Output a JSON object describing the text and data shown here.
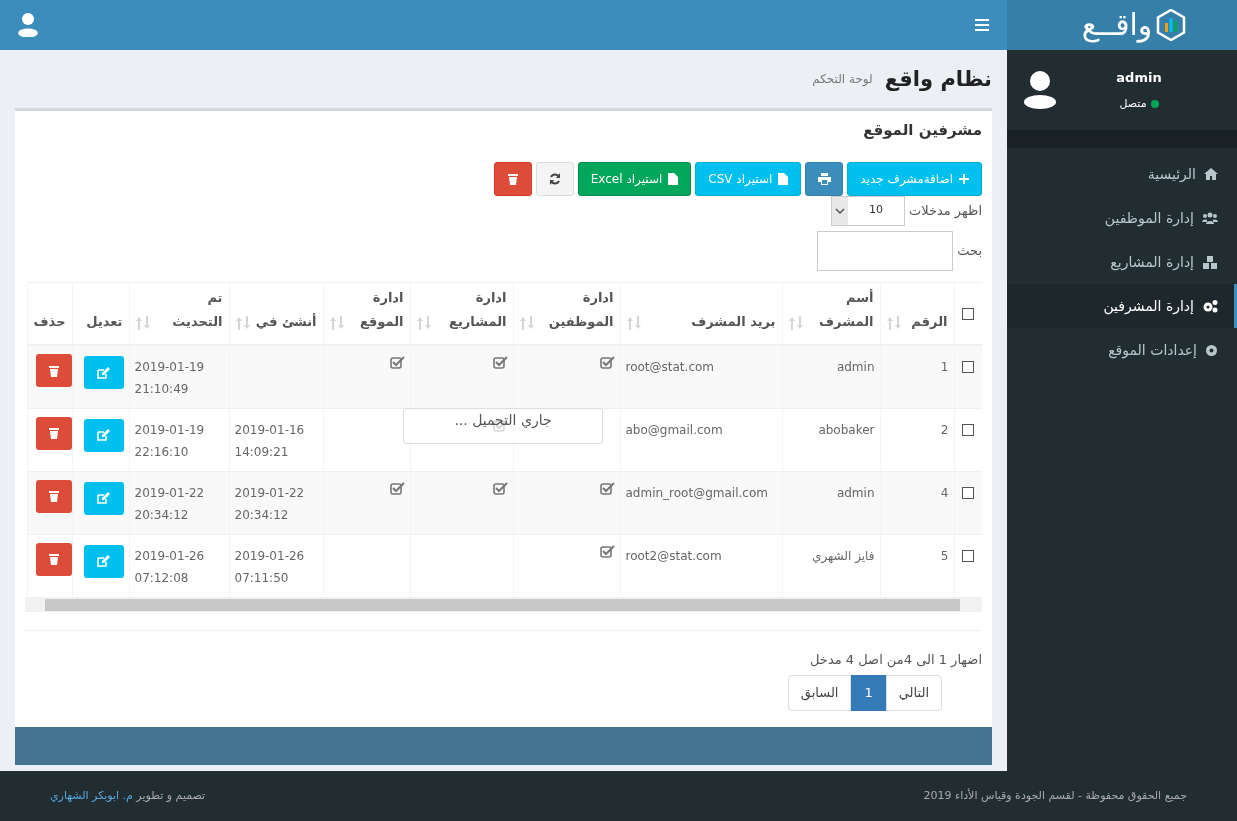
{
  "logo": {
    "text": "واقــع"
  },
  "user_panel": {
    "name": "admin",
    "status": "متصل",
    "online": true
  },
  "sidebar": {
    "items": [
      {
        "label": "الرئيسية",
        "kind": "home",
        "selected": false
      },
      {
        "label": "إدارة الموظفين",
        "kind": "users",
        "selected": false
      },
      {
        "label": "إدارة المشاريع",
        "kind": "cubes",
        "selected": false
      },
      {
        "label": "إدارة المشرفين",
        "kind": "gears",
        "selected": true
      },
      {
        "label": "إعدادات الموقع",
        "kind": "gear",
        "selected": false
      }
    ]
  },
  "page_header": {
    "title": "نظام واقع",
    "subtitle": "لوحة التحكم"
  },
  "box": {
    "title": "مشرفين الموقع",
    "toolbar": [
      {
        "kind": "add",
        "label": "اضافةمشرف جديد"
      },
      {
        "kind": "print"
      },
      {
        "kind": "csv",
        "label": "استيراد CSV"
      },
      {
        "kind": "excel",
        "label": "استيراد Excel"
      },
      {
        "kind": "refresh"
      },
      {
        "kind": "delete"
      }
    ],
    "length": {
      "label": "اظهر مدخلات",
      "value": "10"
    },
    "search": {
      "label": "بحث"
    },
    "table": {
      "select_all": {
        "checked": false
      },
      "columns": [
        "الرقم",
        "أسم المشرف",
        "بريد المشرف",
        "ادارة الموظفين",
        "ادارة المشاريع",
        "ادارة الموقع",
        "أنشئ في",
        "تم التحديث",
        "تعديل",
        "حذف"
      ],
      "rows": [
        {
          "checked": false,
          "number": "1",
          "name": "admin",
          "email": "root@stat.com",
          "employees": true,
          "projects": true,
          "site": true,
          "created": "",
          "updated": "2019-01-19 21:10:49"
        },
        {
          "checked": false,
          "number": "2",
          "name": "abobaker",
          "email": "abo@gmail.com",
          "employees": false,
          "projects": true,
          "site": false,
          "created": "2019-01-16 14:09:21",
          "updated": "2019-01-19 22:16:10"
        },
        {
          "checked": false,
          "number": "4",
          "name": "admin",
          "email": "admin_root@gmail.com",
          "employees": true,
          "projects": true,
          "site": true,
          "created": "2019-01-22 20:34:12",
          "updated": "2019-01-22 20:34:12"
        },
        {
          "checked": false,
          "number": "5",
          "name": "فايز الشهري",
          "email": "root2@stat.com",
          "employees": true,
          "projects": false,
          "site": false,
          "created": "2019-01-26 07:11:50",
          "updated": "2019-01-26 07:12:08"
        }
      ],
      "processing": "جاري التحميل ..."
    },
    "info": "اضهار 1 الى 4من اصل 4 مدخل",
    "pagination": [
      {
        "label": "التالي",
        "selected": false
      },
      {
        "label": "1",
        "selected": true
      },
      {
        "label": "السابق",
        "selected": false
      }
    ]
  },
  "footer": {
    "copyright": "جميع الحقوق محفوظة - لقسم الجودة وقياس الأداء 2019",
    "credit": "تصميم و تطوير",
    "credit_link": "م. ابوبكر الشهاري"
  }
}
